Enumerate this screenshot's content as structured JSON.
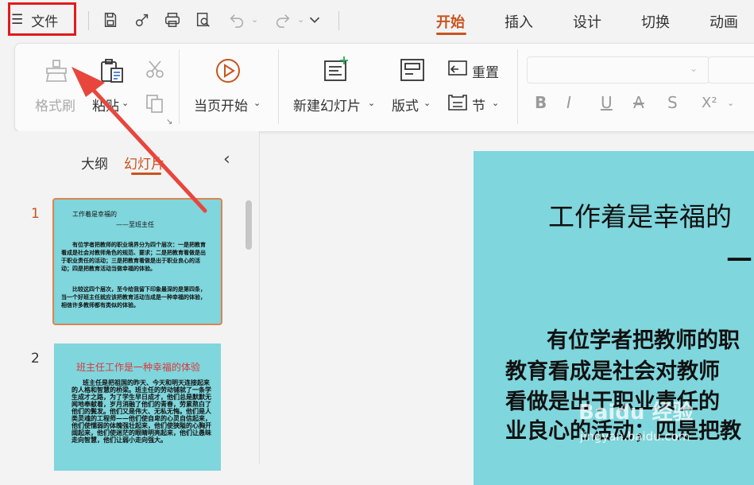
{
  "topbar": {
    "file_label": "文件",
    "menu_icon": "☰",
    "tabs": [
      "开始",
      "插入",
      "设计",
      "切换",
      "动画"
    ],
    "active_tab": "开始"
  },
  "ribbon": {
    "format_painter": "格式刷",
    "paste": "粘贴",
    "play_from_current": "当页开始",
    "new_slide": "新建幻灯片",
    "layout": "版式",
    "reset": "重置",
    "section": "节",
    "bold": "B",
    "italic": "I",
    "underline": "U",
    "strike": "A",
    "shadow": "S",
    "superscript": "X²"
  },
  "leftpane": {
    "tab_outline": "大纲",
    "tab_slides": "幻灯片",
    "collapse": "‹",
    "slides": [
      {
        "num": "1",
        "title": "工作着是幸福的",
        "subtitle": "——至班主任",
        "para1": "有位学者把教师的职业境界分为四个层次：一是把教育看成是社会对教师角色的规范、要求；二是把教育看做是出于职业责任的活动；三是把教育看做是出于职业良心的活动；四是把教育活动当做幸福的体验。",
        "para2": "比较这四个层次，至今给我留下印象最深的是第四条，当一个好班主任就应该把教育活动当成是一种幸福的体验，相信许多教师都有类似的体验。"
      },
      {
        "num": "2",
        "title": "班主任工作是一种幸福的体验",
        "body": "班主任是把祖国的昨天、今天和明天连接起来的人格和智慧的桥梁。班主任的劳动铺就了一条学生成才之路，为了学生早日成才，他们总是默默无闻地奉献着，岁月消融了他们的青春，劳累熬白了他们的鬓发。他们又是伟大、无私无悔。他们是人类灵魂的工程师——他们使自卑的心灵自信起来，他们使懦弱的体魄强壮起来，他们使狭隘的心胸开阔起来，他们使迷茫的眼睛明亮起来，他们让愚昧走向智慧，他们让弱小走向强大。"
      }
    ]
  },
  "slide": {
    "title": "工作着是幸福的",
    "dash": "—",
    "lines": [
      "有位学者把教师的职",
      "教育看成是社会对教师",
      "看做是出于职业责任的",
      "业良心的活动；四是把教"
    ]
  },
  "watermark": {
    "brand": "Baidu 经验",
    "url": "jingyan.baidu.com"
  },
  "colors": {
    "accent": "#c8541f",
    "slide_bg": "#7fd6dc",
    "highlight": "#e11b1b"
  }
}
